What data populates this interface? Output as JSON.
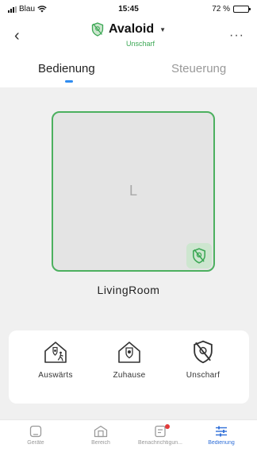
{
  "status_bar": {
    "carrier": "Blau",
    "time": "15:45",
    "battery": "72 %",
    "battery_level": 0.72
  },
  "header": {
    "back_icon": "chevron-left-icon",
    "title": "Avaloid",
    "subtitle": "Unscharf",
    "title_icon": "shield-disarmed-icon",
    "more_icon": "more-dots-icon"
  },
  "tabs": [
    {
      "label": "Bedienung",
      "active": true
    },
    {
      "label": "Steuerung",
      "active": false
    }
  ],
  "room": {
    "letter": "L",
    "name": "LivingRoom",
    "badge_icon": "shield-disarmed-icon"
  },
  "modes": [
    {
      "label": "Auswärts",
      "icon": "house-away-icon"
    },
    {
      "label": "Zuhause",
      "icon": "house-home-icon"
    },
    {
      "label": "Unscharf",
      "icon": "shield-disarmed-icon"
    }
  ],
  "tabbar": [
    {
      "label": "Geräte",
      "icon": "device-icon",
      "active": false
    },
    {
      "label": "Bereich",
      "icon": "area-icon",
      "active": false
    },
    {
      "label": "Benachrichtigun...",
      "icon": "notification-icon",
      "active": false,
      "badge": true
    },
    {
      "label": "Bedienung",
      "icon": "controls-icon",
      "active": true
    }
  ],
  "colors": {
    "accent": "#2f8cf0",
    "armed_green": "#4cb05f",
    "status_green": "#3ca855",
    "active_tab": "#2f6fd8",
    "badge_red": "#e23a3a"
  }
}
